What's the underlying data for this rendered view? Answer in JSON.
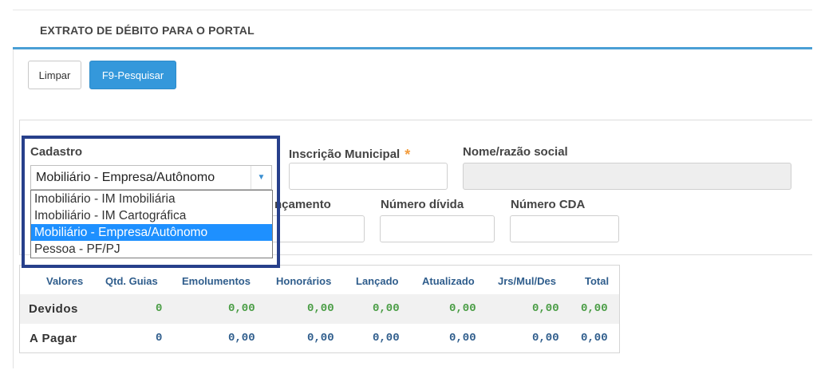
{
  "header": {
    "title": "EXTRATO DE DÉBITO PARA O PORTAL"
  },
  "toolbar": {
    "clear_label": "Limpar",
    "search_label": "F9-Pesquisar"
  },
  "form": {
    "cadastro_label": "Cadastro",
    "cadastro_value": "Mobiliário - Empresa/Autônomo",
    "cadastro_options": [
      "Imobiliário - IM Imobiliária",
      "Imobiliário - IM Cartográfica",
      "Mobiliário - Empresa/Autônomo",
      "Pessoa - PF/PJ"
    ],
    "inscricao_label": "Inscrição Municipal",
    "required_mark": "*",
    "nome_label": "Nome/razão social",
    "lancamento_label_partial": "nçamento",
    "numero_divida_label": "Número dívida",
    "numero_cda_label": "Número CDA"
  },
  "summary": {
    "headers": [
      "Valores",
      "Qtd. Guias",
      "Emolumentos",
      "Honorários",
      "Lançado",
      "Atualizado",
      "Jrs/Mul/Des",
      "Total"
    ],
    "rows": [
      {
        "label": "Devidos",
        "values": [
          "0",
          "0,00",
          "0,00",
          "0,00",
          "0,00",
          "0,00",
          "0,00"
        ]
      },
      {
        "label": "A Pagar",
        "values": [
          "0",
          "0,00",
          "0,00",
          "0,00",
          "0,00",
          "0,00",
          "0,00"
        ]
      }
    ]
  },
  "colors": {
    "accent": "#3498db",
    "highlight_border": "#27408b",
    "devidos_value": "#4a9d45",
    "apagar_value": "#2f5d8c"
  }
}
